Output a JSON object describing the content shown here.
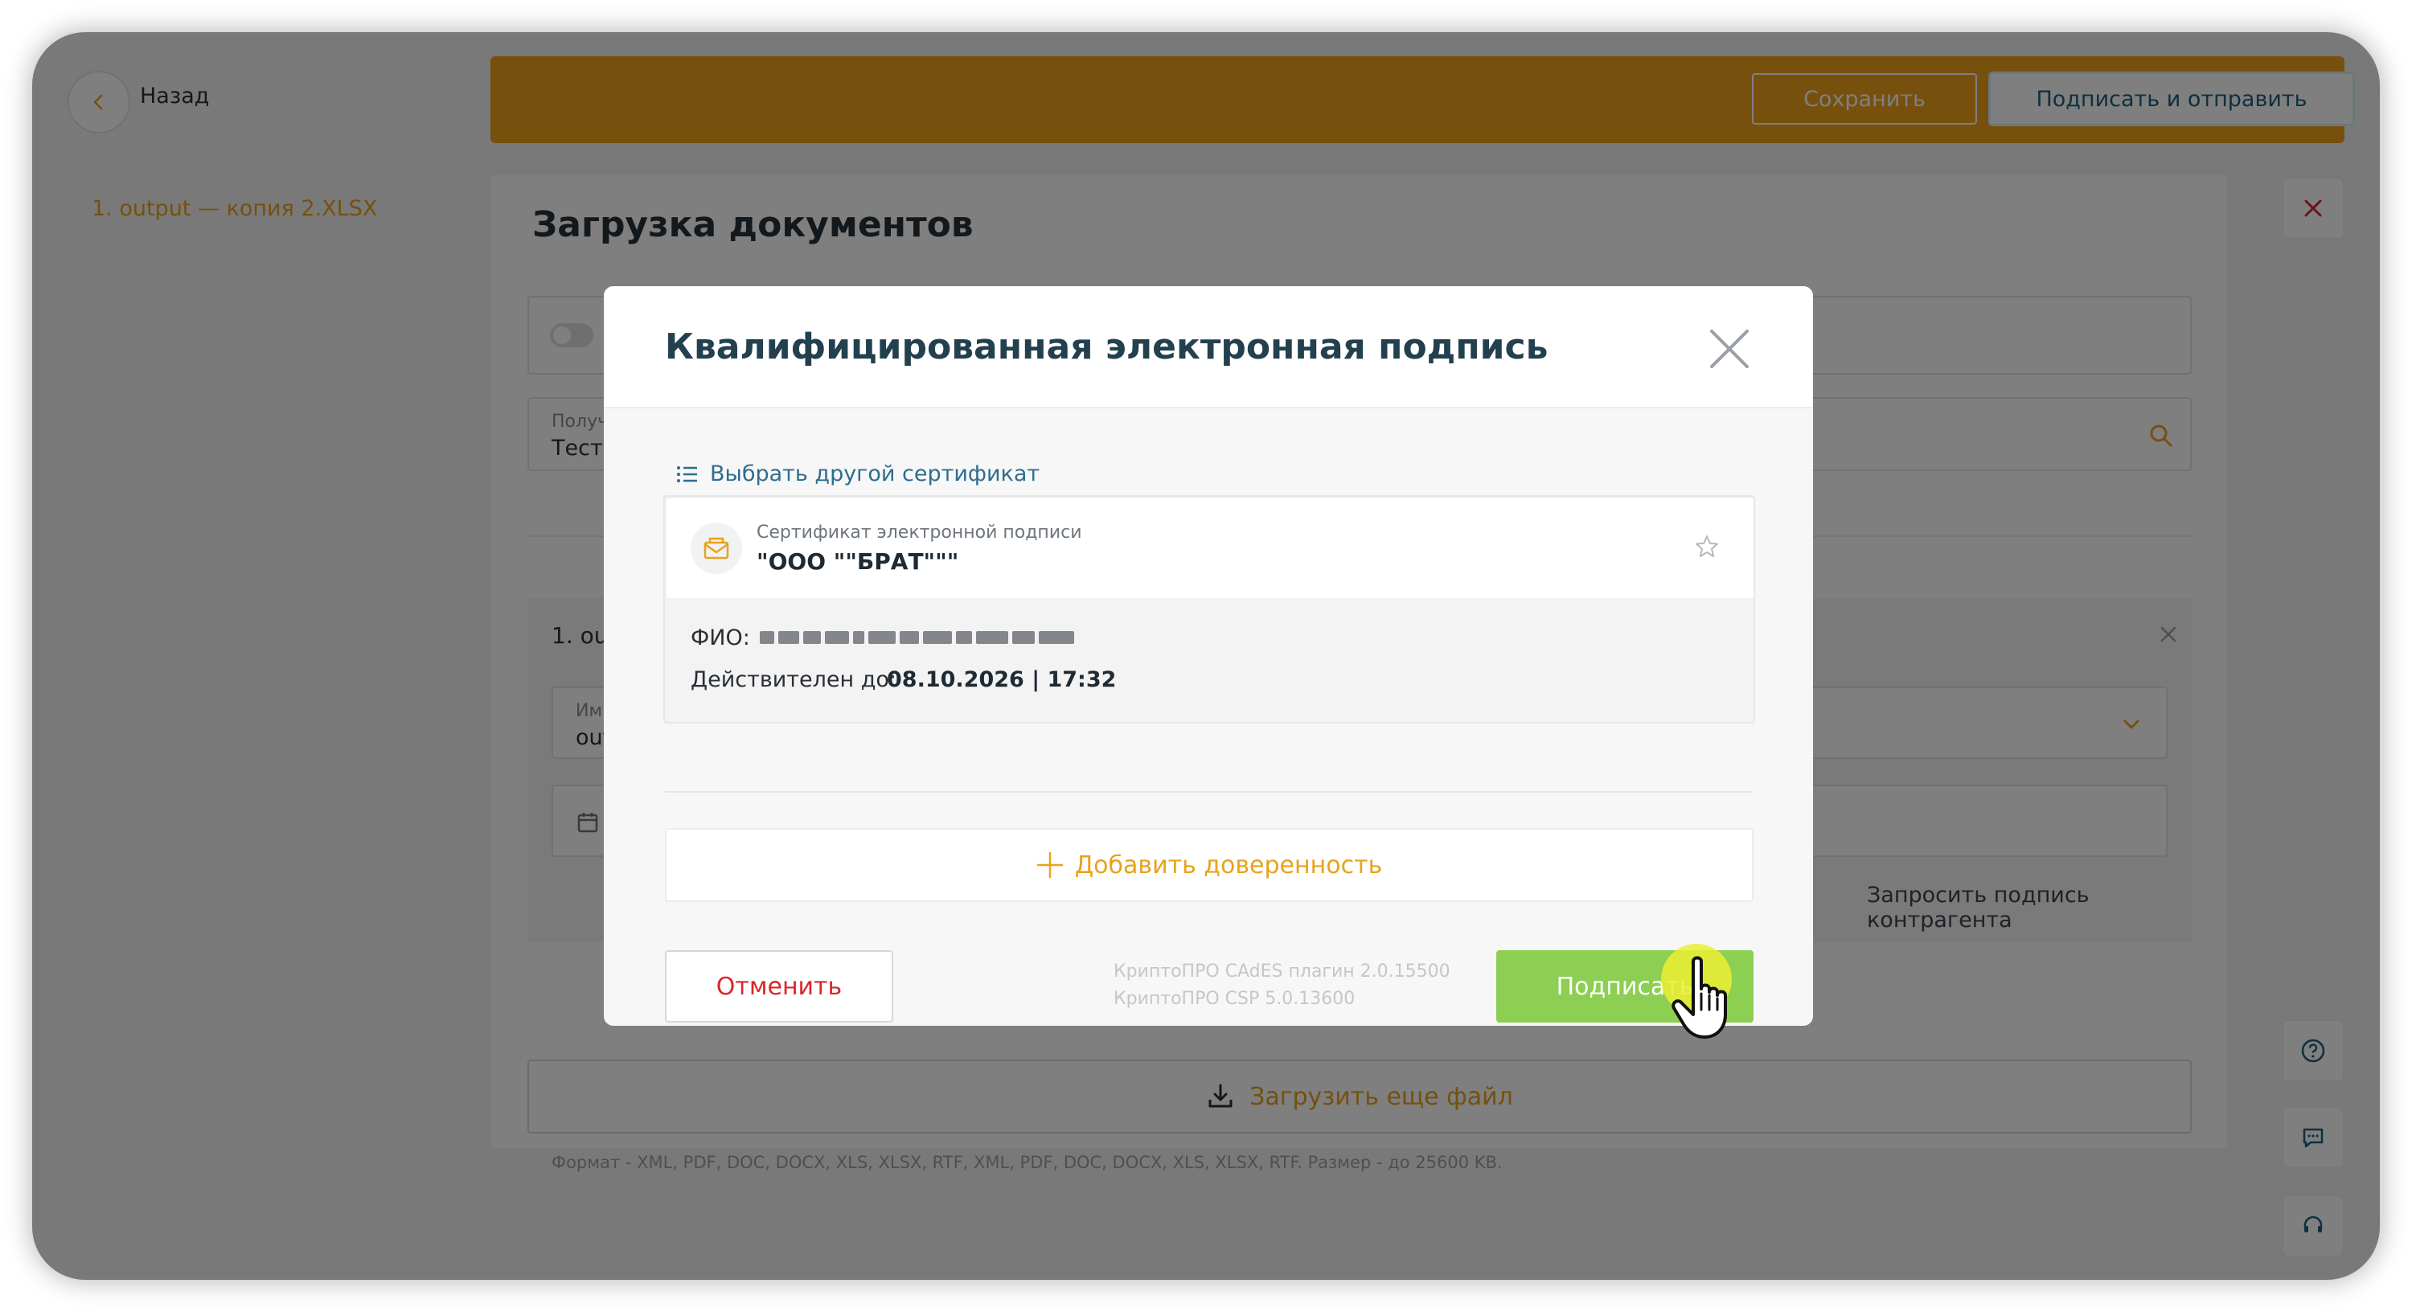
{
  "nav": {
    "back_label": "Назад",
    "document_link": "1. output — копия 2.XLSX"
  },
  "toolbar": {
    "save_label": "Сохранить",
    "sign_send_label": "Подписать и отправить"
  },
  "page": {
    "title": "Загрузка документов",
    "recipient_label_partial": "Получ",
    "recipient_value_partial": "Тесто",
    "doc_item_partial": "1. ou",
    "name_label_partial": "Им",
    "name_value_partial": "out",
    "request_signature_label": "Запросить подпись контрагента",
    "upload_more_label": "Загрузить еще файл",
    "format_hint": "Формат - XML, PDF, DOC, DOCX, XLS, XLSX, RTF, XML, PDF, DOC, DOCX, XLS, XLSX, RTF. Размер - до 25600 KB."
  },
  "modal": {
    "title": "Квалифицированная электронная подпись",
    "choose_cert_label": "Выбрать другой сертификат",
    "cert_type_label": "Сертификат электронной подписи",
    "cert_org": "\"ООО \"\"БРАТ\"\"\"",
    "fio_label": "ФИО:",
    "valid_until_label": "Действителен до:",
    "valid_until_value": "08.10.2026 | 17:32",
    "add_proxy_label": "Добавить доверенность",
    "cancel_label": "Отменить",
    "plugin_version": "КриптоПРО CAdES плагин 2.0.15500",
    "csp_version": "КриптоПРО CSP 5.0.13600",
    "sign_label": "Подписать"
  },
  "colors": {
    "accent_orange": "#f0a11a",
    "sign_green": "#8ccf52",
    "cancel_red": "#d8262a",
    "title_dark_teal": "#23404f"
  }
}
